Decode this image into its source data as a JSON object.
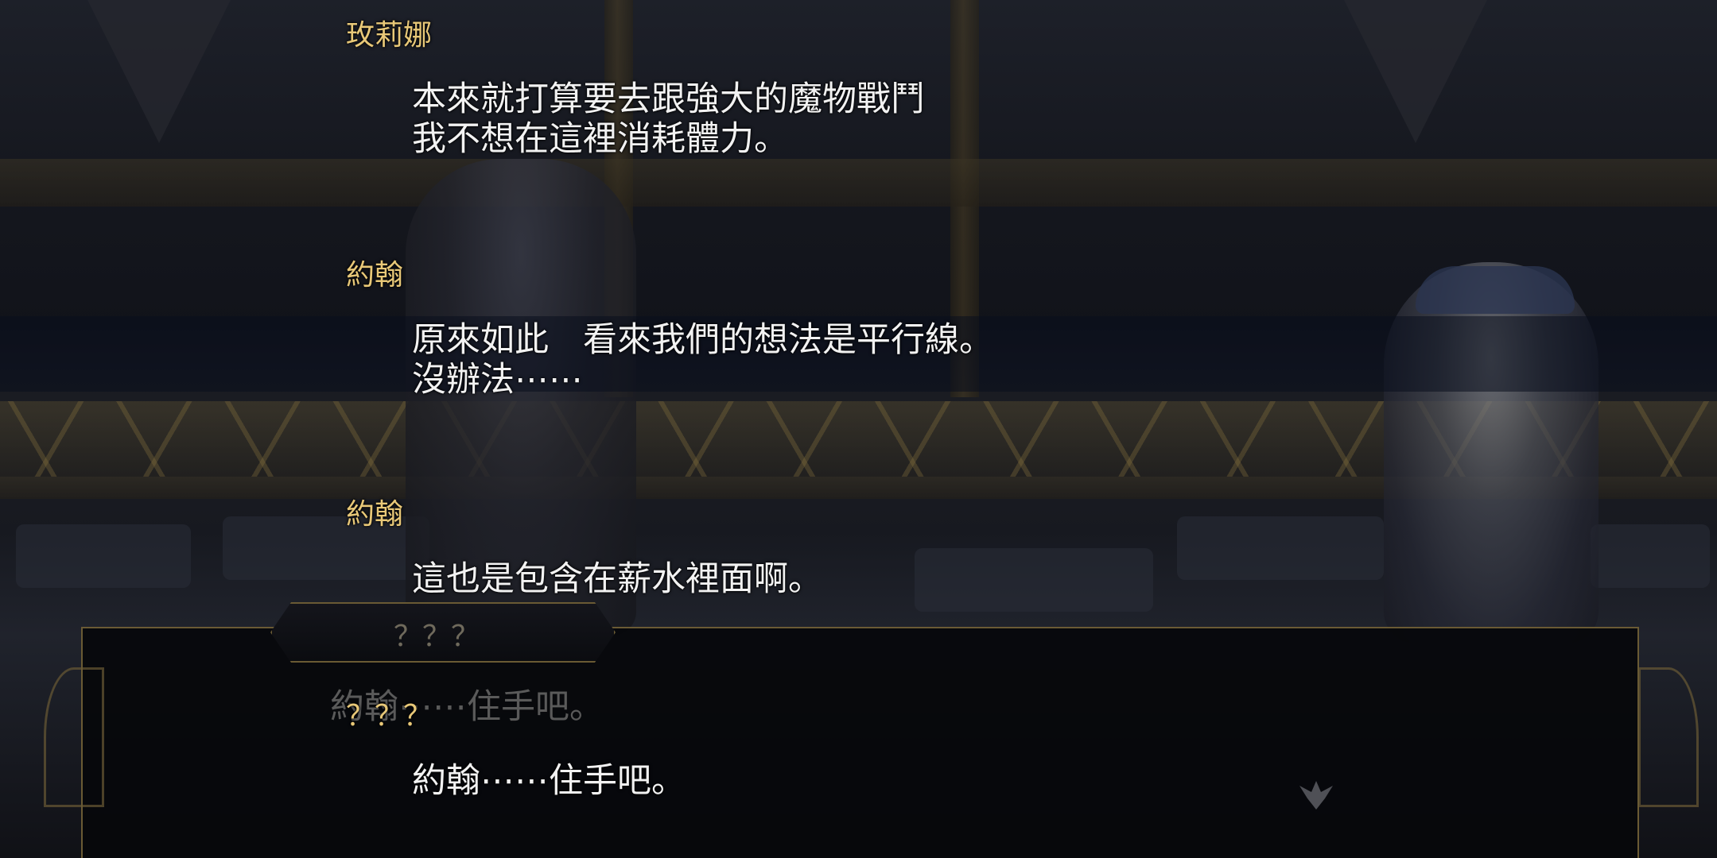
{
  "log": {
    "entries": [
      {
        "speaker": "玫莉娜",
        "text": "本來就打算要去跟強大的魔物戰鬥\n我不想在這裡消耗體力。"
      },
      {
        "speaker": "約翰",
        "text": "原來如此　看來我們的想法是平行線。\n沒辦法⋯⋯"
      },
      {
        "speaker": "約翰",
        "text": "這也是包含在薪水裡面啊。"
      },
      {
        "speaker": "？？？",
        "text": "約翰⋯⋯住手吧。"
      }
    ]
  },
  "dialog": {
    "name": "？？？",
    "text": "約翰⋯⋯住手吧。"
  },
  "icons": {
    "advance": "winged-emblem-icon"
  },
  "colors": {
    "speaker": "#e8c878",
    "text": "#f2f2f2",
    "frame": "#6a5a34"
  }
}
